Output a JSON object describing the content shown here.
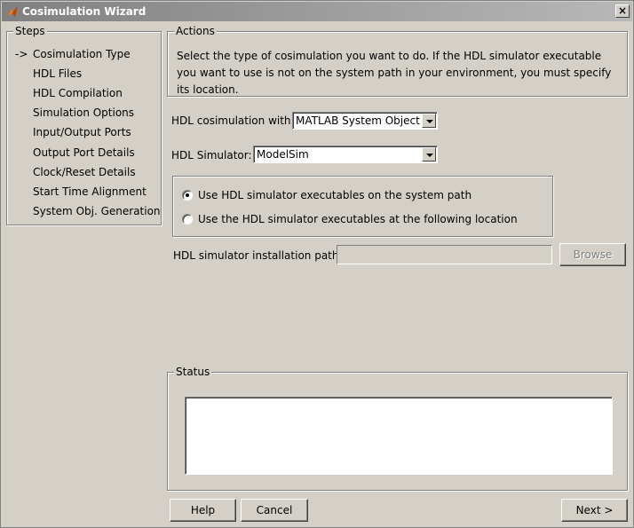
{
  "window": {
    "title": "Cosimulation Wizard",
    "close_label": "×"
  },
  "steps": {
    "label": "Steps",
    "current_marker": "->",
    "items": [
      "Cosimulation Type",
      "HDL Files",
      "HDL Compilation",
      "Simulation Options",
      "Input/Output Ports",
      "Output Port Details",
      "Clock/Reset Details",
      "Start Time Alignment",
      "System Obj. Generation"
    ]
  },
  "actions": {
    "label": "Actions",
    "text": "Select the type of cosimulation you want to do. If the HDL simulator executable you want to use is not on the system path in your environment, you must specify its location."
  },
  "cosim": {
    "label": "HDL cosimulation with:",
    "value": "MATLAB System Object"
  },
  "simulator": {
    "label": "HDL Simulator:",
    "value": "ModelSim"
  },
  "radios": {
    "system_path": "Use HDL simulator executables on the system path",
    "location": "Use the HDL simulator executables at the following location",
    "selected": "system_path"
  },
  "install_path": {
    "label": "HDL simulator installation path:",
    "value": "",
    "browse_label": "Browse"
  },
  "status": {
    "label": "Status",
    "text": ""
  },
  "footer": {
    "help_label": "Help",
    "cancel_label": "Cancel",
    "next_label": "Next >"
  }
}
